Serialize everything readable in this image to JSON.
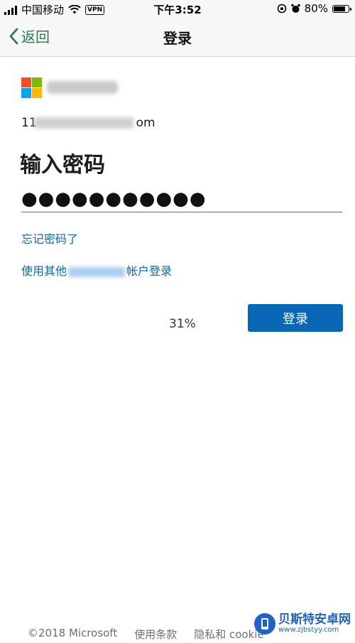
{
  "status_bar": {
    "carrier": "中国移动",
    "vpn": "VPN",
    "time": "下午3:52",
    "battery": "80%",
    "battery_level": 0.8
  },
  "nav": {
    "back_label": "返回",
    "title": "登录"
  },
  "logo_colors": [
    "#f25022",
    "#7fba00",
    "#00a4ef",
    "#ffb900"
  ],
  "account": {
    "email_prefix": "11",
    "email_suffix": "om"
  },
  "heading": "输入密码",
  "password": {
    "value": "●●●●●●●●●●●"
  },
  "links": {
    "forgot": "忘记密码了",
    "other_prefix": "使用其他",
    "other_suffix": "帐户登录"
  },
  "progress": "31%",
  "signin_button": "登录",
  "footer": {
    "copyright": "©2018 Microsoft",
    "terms": "使用条款",
    "privacy": "隐私和 cookie"
  },
  "watermark": {
    "title": "贝斯特安卓网",
    "url": "www.zjbstyy.com"
  },
  "colors": {
    "accent": "#0a67b6",
    "back": "#2a7a4b",
    "link": "#0b67b8"
  }
}
